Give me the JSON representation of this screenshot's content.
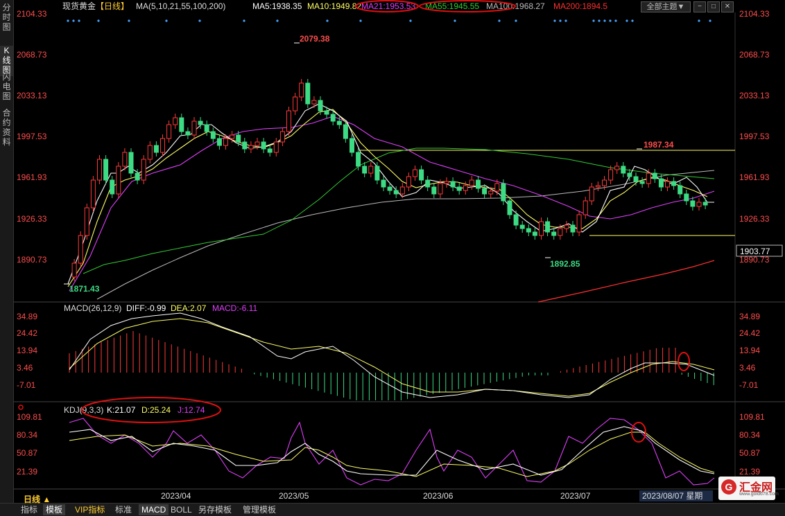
{
  "side_tabs": [
    {
      "label": "分时图"
    },
    {
      "label": "K线图",
      "active": true
    },
    {
      "label": "闪电图"
    },
    {
      "label": "合约资料"
    }
  ],
  "header": {
    "title": "现货黄金",
    "period": "【日线】",
    "ma_label": "MA(5,10,21,55,100,200)",
    "ma5": "MA5:1938.35",
    "ma10": "MA10:1949.82",
    "ma21": "MA21:1953.53",
    "ma55": "MA55:1945.55",
    "ma100": "MA100:1968.27",
    "ma200": "MA200:1894.5"
  },
  "toolbar": {
    "theme_label": "全部主题▼",
    "icon_a": "−",
    "icon_b": "□",
    "icon_c": "✕"
  },
  "price_axis": {
    "ticks": [
      "2104.33",
      "2068.73",
      "2033.13",
      "1997.53",
      "1961.93",
      "1926.33",
      "1890.73"
    ],
    "current": "1903.77"
  },
  "annotations": {
    "high": "2079.38",
    "low_left": "1871.43",
    "high_right": "1987.34",
    "low_mid": "1892.85"
  },
  "macd": {
    "label": "MACD(26,12,9)",
    "diff": "DIFF:-0.99",
    "dea": "DEA:2.07",
    "macd": "MACD:-6.11",
    "ticks": [
      "34.89",
      "24.42",
      "13.94",
      "3.46",
      "-7.01"
    ]
  },
  "kdj": {
    "label": "KDJ(9,3,3)",
    "k": "K:21.07",
    "d": "D:25.24",
    "j": "J:12.74",
    "ticks": [
      "109.81",
      "80.34",
      "50.87",
      "21.39"
    ]
  },
  "time_axis": {
    "labels": [
      "2023/04",
      "2023/05",
      "2023/06",
      "2023/07",
      "2023/08/07 星期"
    ]
  },
  "bottom": {
    "period": "日线 ▲",
    "tabs": [
      "指标",
      "模板",
      "VIP指标",
      "标准",
      "MACD",
      "BOLL",
      "另存模板",
      "管理模板"
    ]
  },
  "logo": {
    "name": "汇金网",
    "url": "www.gold678.com"
  },
  "colors": {
    "up": "#ff3b3b",
    "down": "#3ddc84",
    "ma5": "#ffffff",
    "ma10": "#ffff66",
    "ma21": "#e040fb",
    "ma55": "#33cc33",
    "ma100": "#bbbbbb",
    "ma200": "#ff3030"
  }
}
